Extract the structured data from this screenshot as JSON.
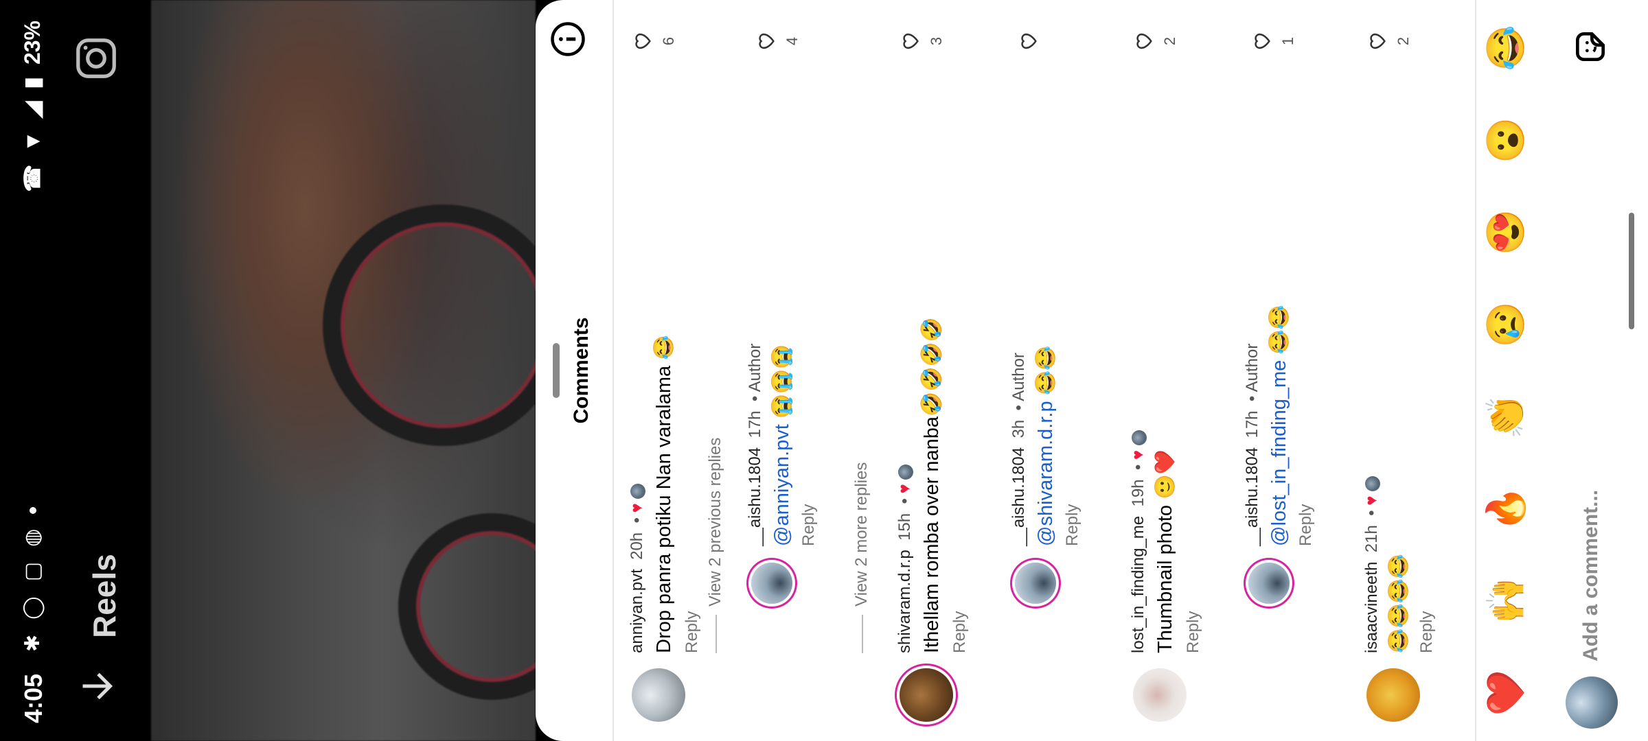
{
  "status": {
    "time": "4:05",
    "battery": "23%"
  },
  "header": {
    "title": "Reels"
  },
  "sheet": {
    "title": "Comments"
  },
  "comments": [
    {
      "user": "anniyan.pvt",
      "time": "20h",
      "text": "Drop panra potiku Nan varalama 😂",
      "reply": "Reply",
      "likes": "6"
    },
    {
      "view_replies": "View 2 previous replies"
    },
    {
      "user": "__aishu.1804",
      "time": "17h",
      "author": "Author",
      "mention": "@anniyan.pvt",
      "text": " 😭😭😭",
      "reply": "Reply",
      "likes": "4"
    },
    {
      "view_replies": "View 2 more replies"
    },
    {
      "user": "shivaram.d.r.p",
      "time": "15h",
      "text": "Ithellam romba over nanba🤣🤣🤣🤣",
      "reply": "Reply",
      "likes": "3"
    },
    {
      "user": "__aishu.1804",
      "time": "3h",
      "author": "Author",
      "mention": "@shivaram.d.r.p",
      "text": " 😂😂",
      "reply": "Reply",
      "likes": ""
    },
    {
      "user": "lost_in_finding_me",
      "time": "19h",
      "text": "Thumbnail photo 🙂❤️",
      "reply": "Reply",
      "likes": "2"
    },
    {
      "user": "__aishu.1804",
      "time": "17h",
      "author": "Author",
      "mention": "@lost_in_finding_me",
      "text": " 😂😂",
      "reply": "Reply",
      "likes": "1"
    },
    {
      "user": "isaacvineeth",
      "time": "21h",
      "text": "😂😂😂😂",
      "reply": "Reply",
      "likes": "2"
    }
  ],
  "emoji_bar": [
    "❤️",
    "🙌",
    "🔥",
    "👏",
    "😢",
    "😍",
    "😮",
    "😂"
  ],
  "input": {
    "placeholder": "Add a comment..."
  }
}
